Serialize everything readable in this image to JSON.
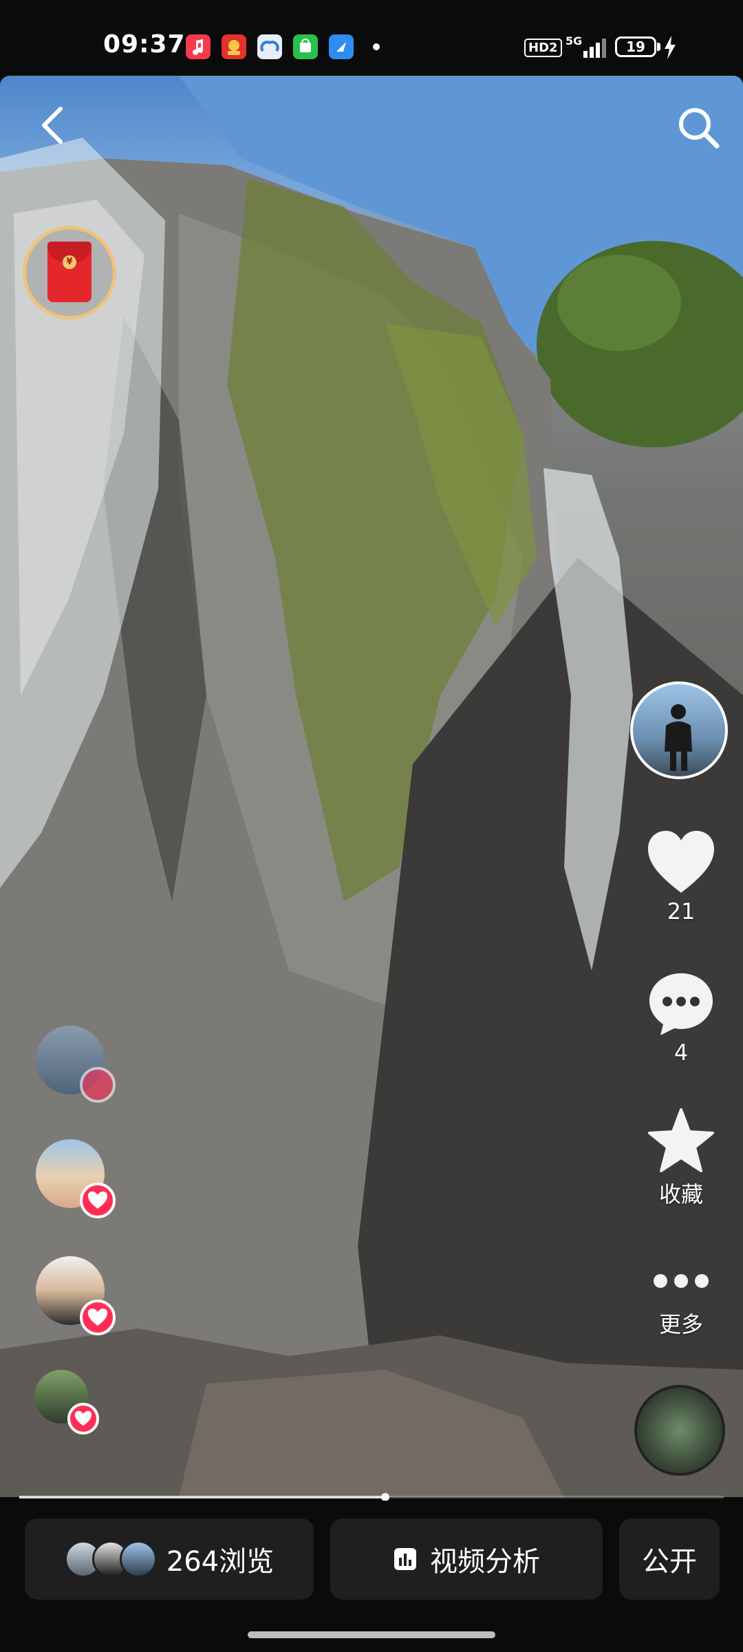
{
  "status_bar": {
    "time": "09:37",
    "network": "5G",
    "hd_label": "HD2",
    "battery": "19",
    "app_icons": [
      "music-app-icon",
      "lucky-app-icon",
      "cloud-app-icon",
      "shop-app-icon",
      "browser-app-icon"
    ]
  },
  "video": {
    "playback_progress": 0.52
  },
  "side_actions": {
    "like_count": "21",
    "comment_count": "4",
    "favorite_label": "收藏",
    "more_label": "更多"
  },
  "bottom": {
    "views_label": "264浏览",
    "analysis_label": "视频分析",
    "public_label": "公开"
  },
  "colors": {
    "accent_heart": "#ff2d55",
    "redpacket": "#e4272b",
    "pill_bg": "#1f1f1f"
  }
}
